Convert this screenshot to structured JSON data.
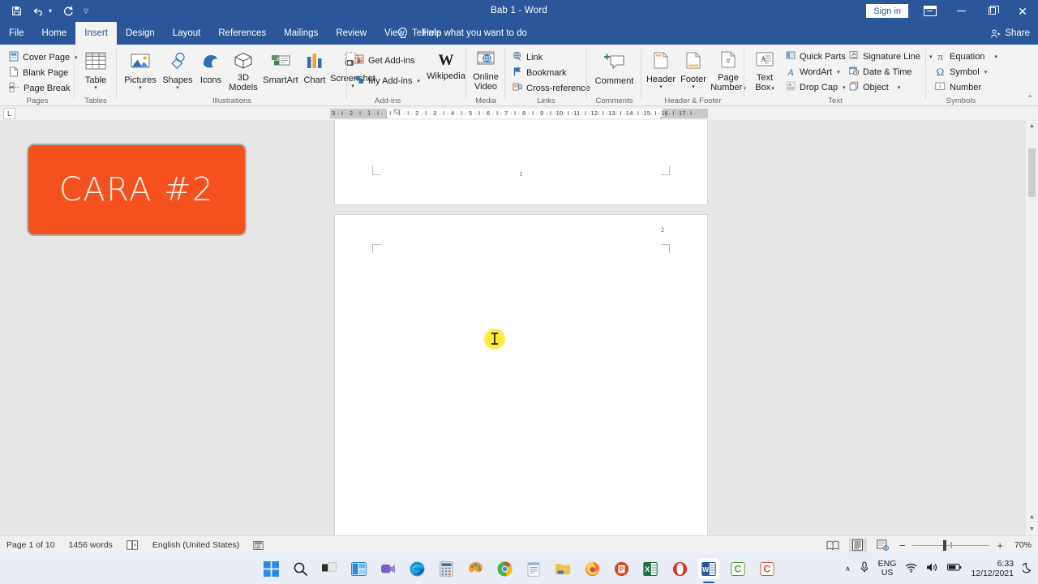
{
  "titlebar": {
    "quick_access": [
      {
        "name": "save-icon",
        "glyph": "ὋE"
      },
      {
        "name": "undo-icon",
        "glyph": "↶"
      },
      {
        "name": "redo-icon",
        "glyph": "↻"
      },
      {
        "name": "customize-qat-icon",
        "glyph": "▽"
      }
    ],
    "document_title": "Bab 1  -  Word",
    "sign_in_label": "Sign in",
    "window_buttons": [
      "ribbon-display-options",
      "minimize",
      "restore",
      "close"
    ]
  },
  "tabs": [
    {
      "label": "File",
      "active": false
    },
    {
      "label": "Home",
      "active": false
    },
    {
      "label": "Insert",
      "active": true
    },
    {
      "label": "Design",
      "active": false
    },
    {
      "label": "Layout",
      "active": false
    },
    {
      "label": "References",
      "active": false
    },
    {
      "label": "Mailings",
      "active": false
    },
    {
      "label": "Review",
      "active": false
    },
    {
      "label": "View",
      "active": false
    },
    {
      "label": "Help",
      "active": false
    }
  ],
  "tell_me": "Tell me what you want to do",
  "share_label": "Share",
  "ribbon": {
    "groups": [
      {
        "name": "Pages",
        "items": [
          {
            "label": "Cover Page",
            "caret": true
          },
          {
            "label": "Blank Page",
            "caret": false
          },
          {
            "label": "Page Break",
            "caret": false
          }
        ]
      },
      {
        "name": "Tables",
        "items": [
          {
            "label": "Table",
            "caret": true
          }
        ]
      },
      {
        "name": "Illustrations",
        "items": [
          {
            "label": "Pictures",
            "caret": true
          },
          {
            "label": "Shapes",
            "caret": true
          },
          {
            "label": "Icons",
            "caret": false
          },
          {
            "label": "3D\nModels",
            "caret": true
          },
          {
            "label": "SmartArt",
            "caret": false
          },
          {
            "label": "Chart",
            "caret": false
          },
          {
            "label": "Screenshot",
            "caret": true
          }
        ]
      },
      {
        "name": "Add-ins",
        "items": [
          {
            "label": "Get Add-ins",
            "caret": false
          },
          {
            "label": "My Add-ins",
            "caret": true
          },
          {
            "label": "Wikipedia",
            "caret": false
          }
        ]
      },
      {
        "name": "Media",
        "items": [
          {
            "label": "Online\nVideo",
            "caret": false
          }
        ]
      },
      {
        "name": "Links",
        "items": [
          {
            "label": "Link",
            "caret": false
          },
          {
            "label": "Bookmark",
            "caret": false
          },
          {
            "label": "Cross-reference",
            "caret": false
          }
        ]
      },
      {
        "name": "Comments",
        "items": [
          {
            "label": "Comment",
            "caret": false
          }
        ]
      },
      {
        "name": "Header & Footer",
        "items": [
          {
            "label": "Header",
            "caret": true
          },
          {
            "label": "Footer",
            "caret": true
          },
          {
            "label": "Page\nNumber",
            "caret": true
          }
        ]
      },
      {
        "name": "Text",
        "items": [
          {
            "label": "Text\nBox",
            "caret": true
          },
          {
            "label": "Quick Parts",
            "caret": true
          },
          {
            "label": "WordArt",
            "caret": true
          },
          {
            "label": "Drop Cap",
            "caret": true
          },
          {
            "label": "Signature Line",
            "caret": true
          },
          {
            "label": "Date & Time",
            "caret": false
          },
          {
            "label": "Object",
            "caret": true
          }
        ]
      },
      {
        "name": "Symbols",
        "items": [
          {
            "label": "Equation",
            "caret": true
          },
          {
            "label": "Symbol",
            "caret": true
          },
          {
            "label": "Number",
            "caret": false
          }
        ]
      }
    ],
    "labels": {
      "pages": "Pages",
      "tables": "Tables",
      "illustrations": "Illustrations",
      "addins": "Add-ins",
      "media": "Media",
      "links": "Links",
      "comments": "Comments",
      "headerfooter": "Header & Footer",
      "text": "Text",
      "symbols": "Symbols"
    },
    "item_labels": {
      "cover_page": "Cover Page",
      "blank_page": "Blank Page",
      "page_break": "Page Break",
      "table": "Table",
      "pictures": "Pictures",
      "shapes": "Shapes",
      "icons": "Icons",
      "models3d_1": "3D",
      "models3d_2": "Models",
      "smartart": "SmartArt",
      "chart": "Chart",
      "screenshot": "Screenshot",
      "get_addins": "Get Add-ins",
      "my_addins": "My Add-ins",
      "wikipedia": "Wikipedia",
      "online_1": "Online",
      "online_2": "Video",
      "link": "Link",
      "bookmark": "Bookmark",
      "cross_reference": "Cross-reference",
      "comment": "Comment",
      "header": "Header",
      "footer": "Footer",
      "page_number_1": "Page",
      "page_number_2": "Number",
      "text_box_1": "Text",
      "text_box_2": "Box",
      "quick_parts": "Quick Parts",
      "wordart": "WordArt",
      "drop_cap": "Drop Cap",
      "signature_line": "Signature Line",
      "date_time": "Date & Time",
      "object": "Object",
      "equation": "Equation",
      "symbol": "Symbol",
      "number": "Number"
    }
  },
  "ruler": {
    "tab_selector": "L",
    "marks": "3 · I · 2 · I · 1 · I ·      · I · 1 · I · 2 · I · 3 · I · 4 · I · 5 · I · 6 · I · 7 · I · 8 · I · 9 · I ·10· I ·11· I ·12· I ·13· I ·14· I ·15· I ·16· I ·17· I ·"
  },
  "document": {
    "page1_number": "1",
    "page2_number": "2"
  },
  "overlay": {
    "cara_text": "CARA #2",
    "cara_bg_color": "#f4511e",
    "cara_text_color": "#fdf2ea",
    "cara_border_color": "#9fb3ab"
  },
  "cursor": {
    "type": "text-ibeam",
    "highlight_color": "#ffe93a"
  },
  "statusbar": {
    "page_label": "Page 1 of 10",
    "word_count": "1456 words",
    "language": "English (United States)",
    "views": [
      "read-mode",
      "print-layout",
      "web-layout"
    ],
    "selected_view": "print-layout",
    "zoom_out": "−",
    "zoom_in": "+",
    "zoom_level": "70%"
  },
  "taskbar": {
    "icons": [
      "start-icon",
      "search-icon",
      "task-view-icon",
      "widgets-icon",
      "teams-icon",
      "edge-icon",
      "calculator-icon",
      "paint-icon",
      "chrome-icon",
      "notepad-icon",
      "file-explorer-icon",
      "firefox-icon",
      "powerpoint-icon",
      "excel-icon",
      "opera-icon",
      "word-icon",
      "app-green-icon",
      "app-red-icon"
    ],
    "active_app": "word-icon",
    "tray": {
      "overflow": "∧",
      "language_line1": "ENG",
      "language_line2": "US",
      "time": "6:33",
      "date": "12/12/2021"
    }
  }
}
